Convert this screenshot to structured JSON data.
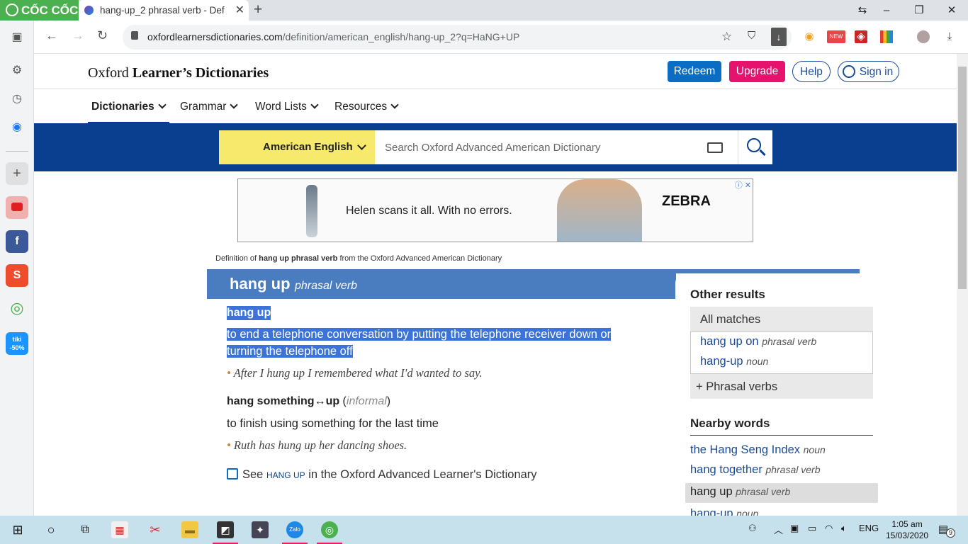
{
  "browser": {
    "brand": "CỐC CỐC",
    "tab_title": "hang-up_2 phrasal verb - Def",
    "tab_close": "✕",
    "new_tab": "+",
    "url_host": "oxfordlearnersdictionaries.com",
    "url_path": "/definition/american_english/hang-up_2?q=HaNG+UP",
    "win_min": "–",
    "win_max": "❐",
    "win_close": "✕",
    "win_restore": "⇆"
  },
  "site": {
    "logo_prefix": "Oxford ",
    "logo_bold": "Learner’s Dictionaries",
    "redeem": "Redeem",
    "upgrade": "Upgrade",
    "help": "Help",
    "signin": "Sign in",
    "menu": [
      "Dictionaries",
      "Grammar",
      "Word Lists",
      "Resources"
    ],
    "dict_select": "American English",
    "search_placeholder": "Search Oxford Advanced American Dictionary"
  },
  "ad": {
    "text": "Helen scans it all. With no errors.",
    "brand": "ZEBRA",
    "close": "ⓘ ✕"
  },
  "entry": {
    "source_pre": "Definition of ",
    "source_bold": "hang up phrasal verb",
    "source_post": " from the Oxford Advanced American Dictionary",
    "headword": "hang up",
    "pos": "phrasal verb",
    "sense1_label": "hang up",
    "sense1_def": "to end a telephone conversation by putting the telephone receiver down or turning the telephone off",
    "sense1_example": "After I hung up I remembered what I'd wanted to say.",
    "sense2_label_a": "hang something",
    "sense2_arrow": "↔",
    "sense2_label_b": "up",
    "sense2_reg": "informal",
    "sense2_def": "to finish using something for the last time",
    "sense2_example": "Ruth has hung up her dancing shoes.",
    "see_pre": "See ",
    "see_sc": "HANG UP",
    "see_post": " in the Oxford Advanced Learner's Dictionary"
  },
  "sidebar_right": {
    "other_results": "Other results",
    "all_matches": "All matches",
    "matches": [
      {
        "word": "hang up on",
        "pos": "phrasal verb"
      },
      {
        "word": "hang-up",
        "pos": "noun"
      }
    ],
    "phrasal_verbs": "Phrasal verbs",
    "nearby_words": "Nearby words",
    "nearby": [
      {
        "word": "the Hang Seng Index",
        "pos": "noun"
      },
      {
        "word": "hang together",
        "pos": "phrasal verb"
      },
      {
        "word": "hang up",
        "pos": "phrasal verb"
      },
      {
        "word": "hang-up",
        "pos": "noun"
      }
    ]
  },
  "taskbar": {
    "lang": "ENG",
    "time": "1:05 am",
    "date": "15/03/2020",
    "notif": "9",
    "zalo": "Zalo"
  },
  "colors": {
    "brand_blue": "#0a3f8f",
    "redeem": "#0a6cc2",
    "upgrade": "#e6136e",
    "dict_select": "#f6e96b",
    "headword_bar": "#4a7cc0",
    "selection": "#3b73d8"
  }
}
